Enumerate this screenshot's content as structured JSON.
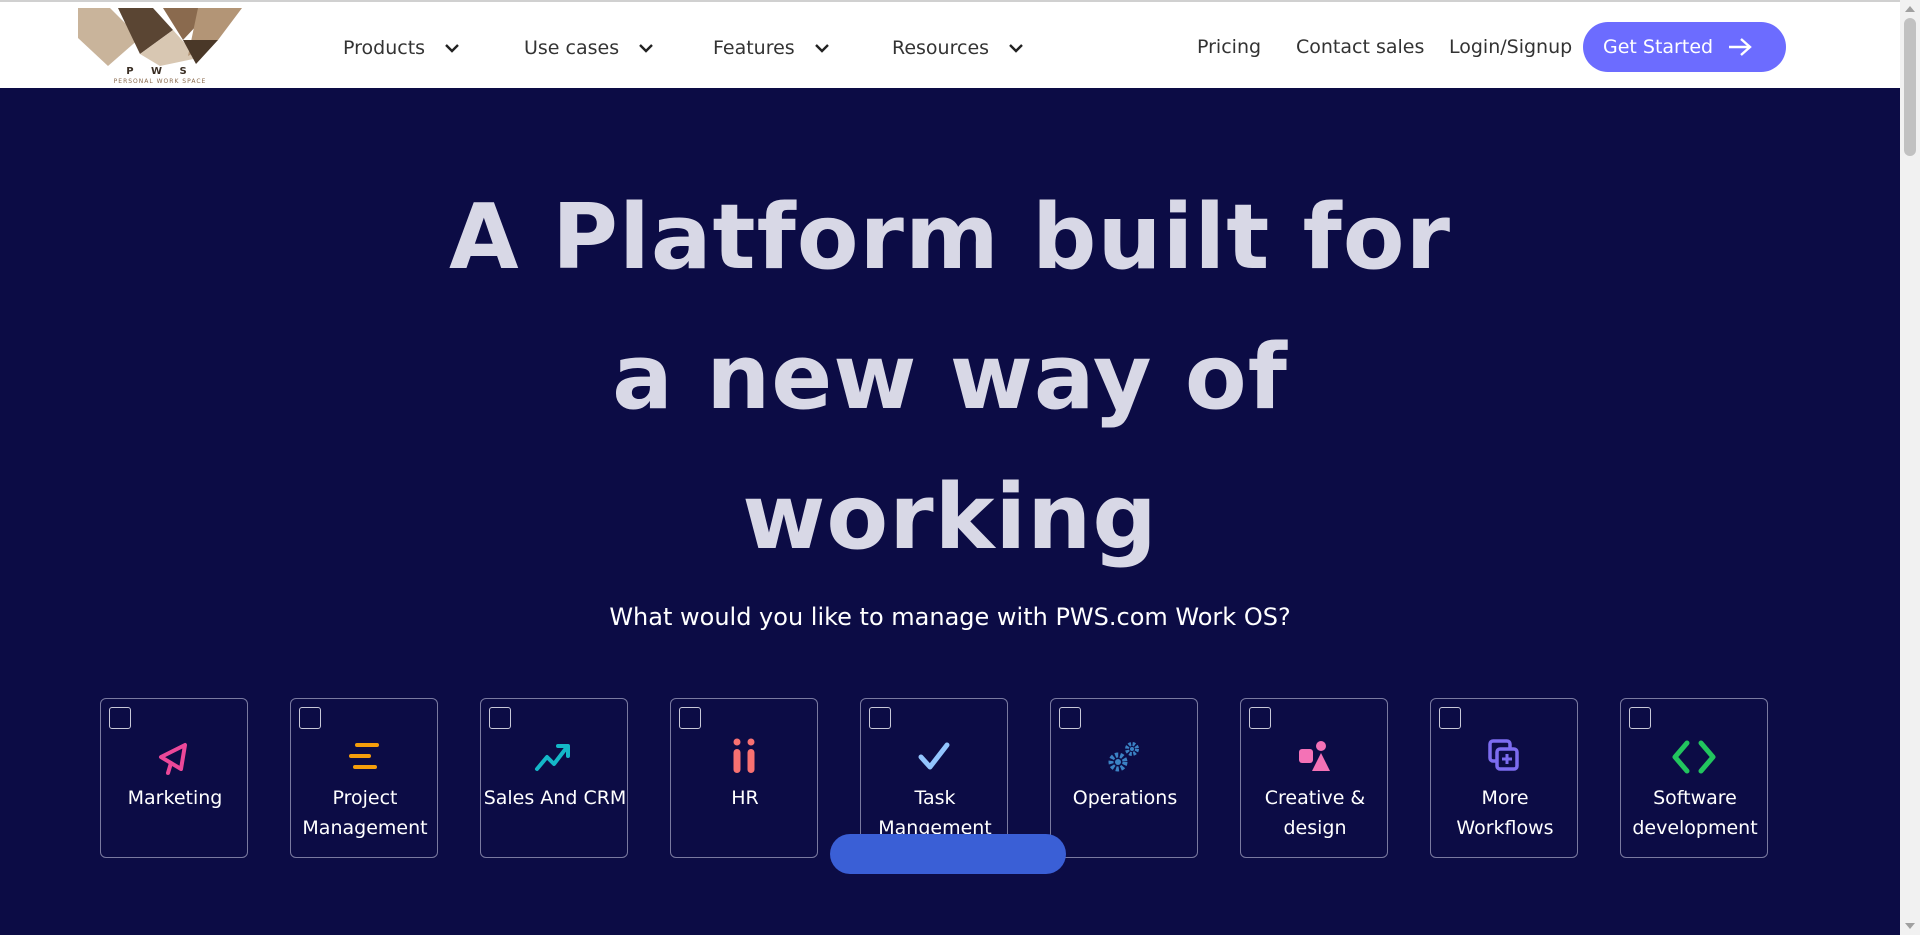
{
  "brand": {
    "logo_text": "P W S",
    "logo_subtext": "PERSONAL WORK SPACE"
  },
  "nav": {
    "menus": [
      {
        "label": "Products"
      },
      {
        "label": "Use cases"
      },
      {
        "label": "Features"
      },
      {
        "label": "Resources"
      }
    ],
    "links": [
      {
        "label": "Pricing"
      },
      {
        "label": "Contact sales"
      },
      {
        "label": "Login/Signup"
      }
    ],
    "cta": "Get Started"
  },
  "hero": {
    "title_line1": "A Platform built for",
    "title_line2": "a new way of",
    "title_line3": "working",
    "subtitle": "What would you like to manage with PWS.com Work OS?"
  },
  "workflows": [
    {
      "label": "Marketing",
      "icon": "megaphone-icon",
      "color": "#ec4899"
    },
    {
      "label": "Project Management",
      "icon": "list-lines-icon",
      "color": "#f59e0b"
    },
    {
      "label": "Sales And CRM",
      "icon": "trend-up-icon",
      "color": "#14b8c8"
    },
    {
      "label": "HR",
      "icon": "people-icon",
      "color": "#f87171"
    },
    {
      "label": "Task Mangement",
      "icon": "checkmark-icon",
      "color": "#93c5fd"
    },
    {
      "label": "Operations",
      "icon": "gears-icon",
      "color": "#3b82c4"
    },
    {
      "label": "Creative & design",
      "icon": "shapes-icon",
      "color": "#f472b6"
    },
    {
      "label": "More Workflows",
      "icon": "add-layers-icon",
      "color": "#7c6cf0"
    },
    {
      "label": "Software development",
      "icon": "code-brackets-icon",
      "color": "#22c55e"
    }
  ],
  "colors": {
    "hero_bg": "#0c0c45",
    "accent": "#6c6cff",
    "header_bg": "#ffffff"
  }
}
